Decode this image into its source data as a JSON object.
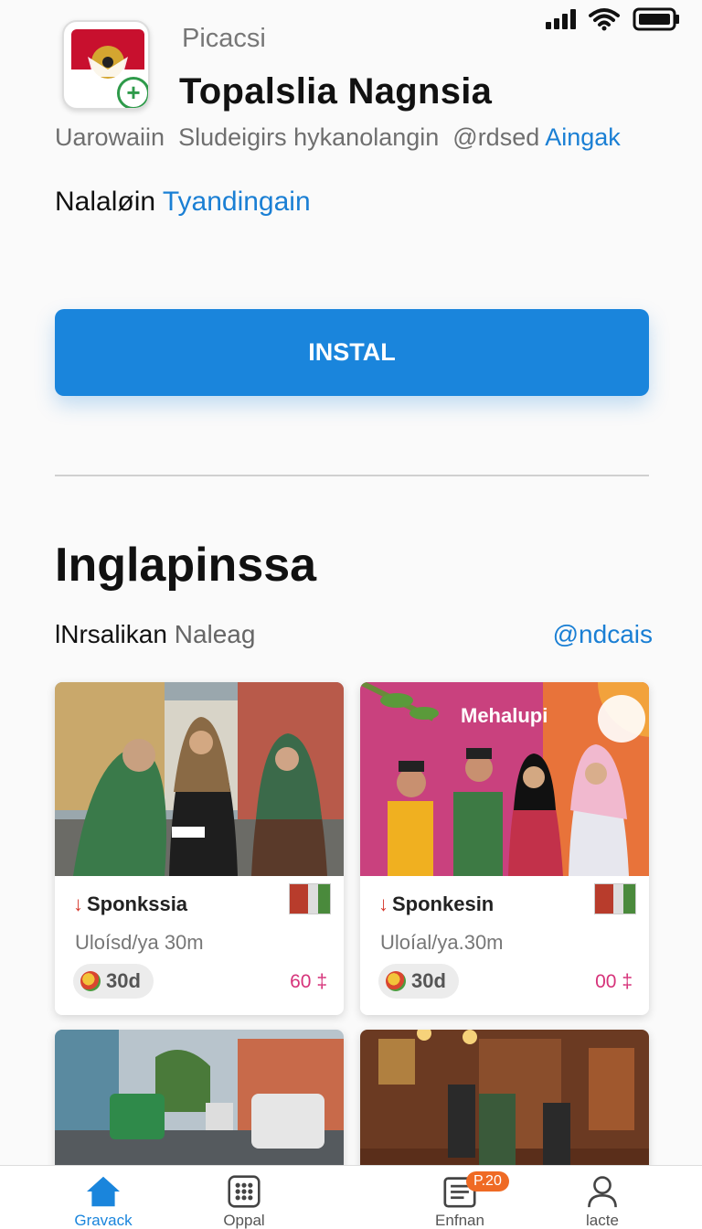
{
  "status_bar": {
    "icons": [
      "signal-icon",
      "wifi-icon",
      "battery-icon"
    ]
  },
  "header": {
    "publisher": "Picacsi",
    "title": "Topalslia Nagnsia",
    "meta_parts": [
      "Uarowaiin",
      "Sludeigirs hykanolangin",
      "@rdsed"
    ],
    "meta_link": "Aingak",
    "sub_text": "Nalaløin",
    "sub_link": "Tyandingain"
  },
  "install_button": {
    "label": "INSTAL",
    "color": "#1a85dc"
  },
  "section": {
    "title": "Inglapinssa",
    "filter_label": "lNrsalikan",
    "filter_muted": "Naleag",
    "filter_link": "@ndcais"
  },
  "cards": [
    {
      "name": "Sponkssia",
      "subtitle": "Uloísd/ya 30m",
      "rating": "30d",
      "price": "60 ‡"
    },
    {
      "name": "Sponkesin",
      "subtitle": "Uloíal/ya.30m",
      "rating": "30d",
      "price": "00 ‡",
      "banner_text": "Mehalupi"
    }
  ],
  "bottom_nav": {
    "items": [
      {
        "label": "Gravack",
        "icon": "home-icon",
        "active": true
      },
      {
        "label": "Oppal",
        "icon": "grid-icon",
        "active": false
      },
      {
        "label": "Enfnan",
        "icon": "news-icon",
        "active": false,
        "badge": "P.20"
      },
      {
        "label": "lacte",
        "icon": "profile-icon",
        "active": false
      }
    ]
  },
  "colors": {
    "accent": "#1a7fd4",
    "button": "#1a85dc",
    "price": "#d6337a",
    "badge": "#ef6a24"
  }
}
